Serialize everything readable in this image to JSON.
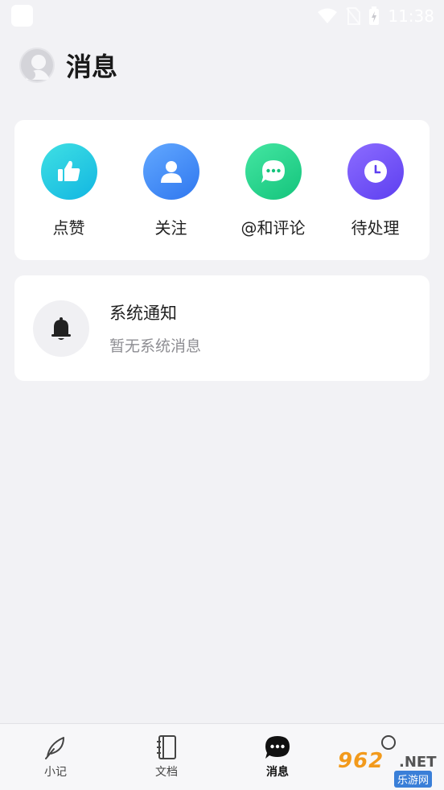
{
  "status_bar": {
    "time": "11:38"
  },
  "header": {
    "title": "消息"
  },
  "actions": [
    {
      "label": "点赞",
      "icon": "thumbs-up-icon",
      "color": "#12b6e2"
    },
    {
      "label": "关注",
      "icon": "user-icon",
      "color": "#2f77ef"
    },
    {
      "label": "@和评论",
      "icon": "chat-bubble-icon",
      "color": "#14c47c"
    },
    {
      "label": "待处理",
      "icon": "clock-icon",
      "color": "#5d3ff0"
    }
  ],
  "system_notice": {
    "title": "系统通知",
    "subtitle": "暂无系统消息",
    "icon": "bell-icon"
  },
  "tabs": [
    {
      "label": "小记",
      "icon": "feather-icon",
      "active": false
    },
    {
      "label": "文档",
      "icon": "notebook-icon",
      "active": false
    },
    {
      "label": "消息",
      "icon": "message-icon",
      "active": true
    },
    {
      "label": "",
      "icon": "profile-icon",
      "active": false
    }
  ],
  "watermark": {
    "brand": "962",
    "net": ".NET",
    "site": "乐游网"
  }
}
